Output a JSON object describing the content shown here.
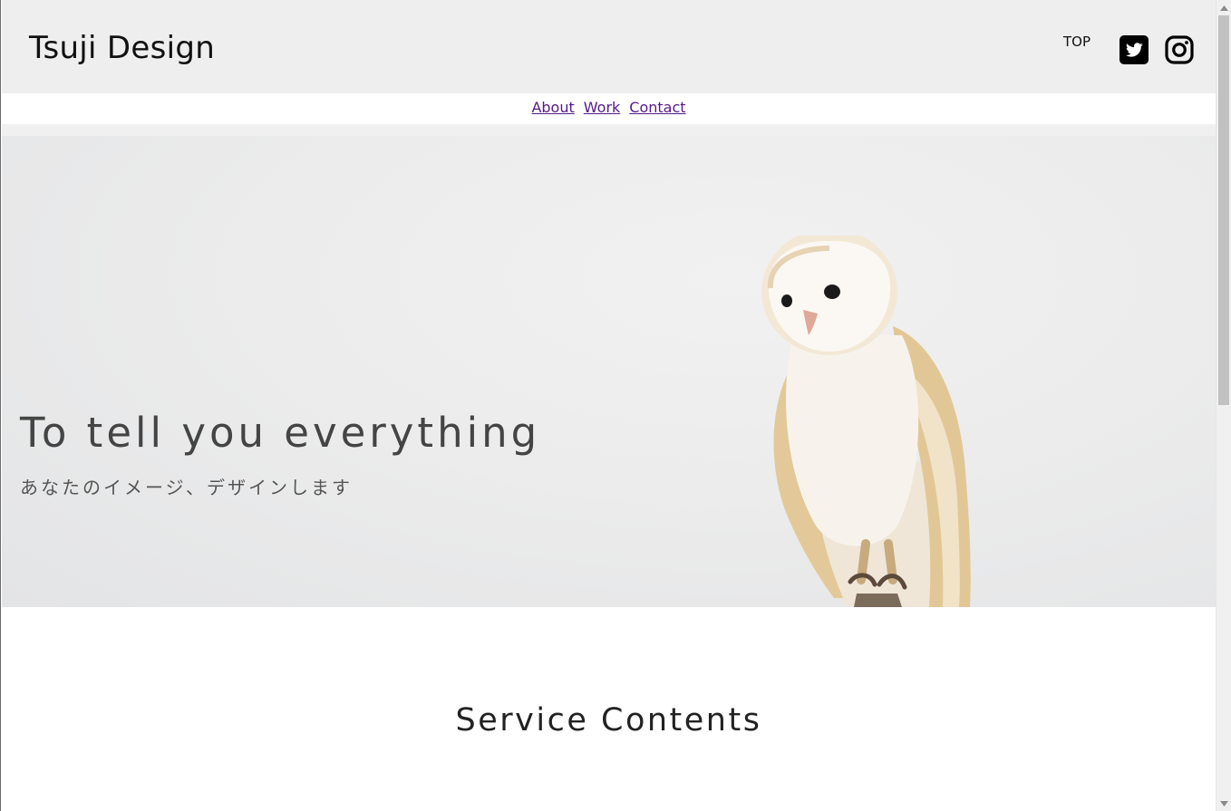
{
  "header": {
    "logo": "Tsuji Design",
    "top_link": "TOP",
    "social": [
      {
        "icon": "twitter-icon"
      },
      {
        "icon": "instagram-icon"
      }
    ]
  },
  "nav": {
    "items": [
      {
        "label": "About"
      },
      {
        "label": "Work"
      },
      {
        "label": "Contact"
      }
    ]
  },
  "hero": {
    "title": "To tell you everything",
    "subtitle": "あなたのイメージ、デザインします",
    "image": "barn-owl-photo"
  },
  "service": {
    "title": "Service Contents"
  },
  "colors": {
    "header_bg": "#eeeeee",
    "link_visited": "#551a8b",
    "hero_text": "#444444"
  }
}
